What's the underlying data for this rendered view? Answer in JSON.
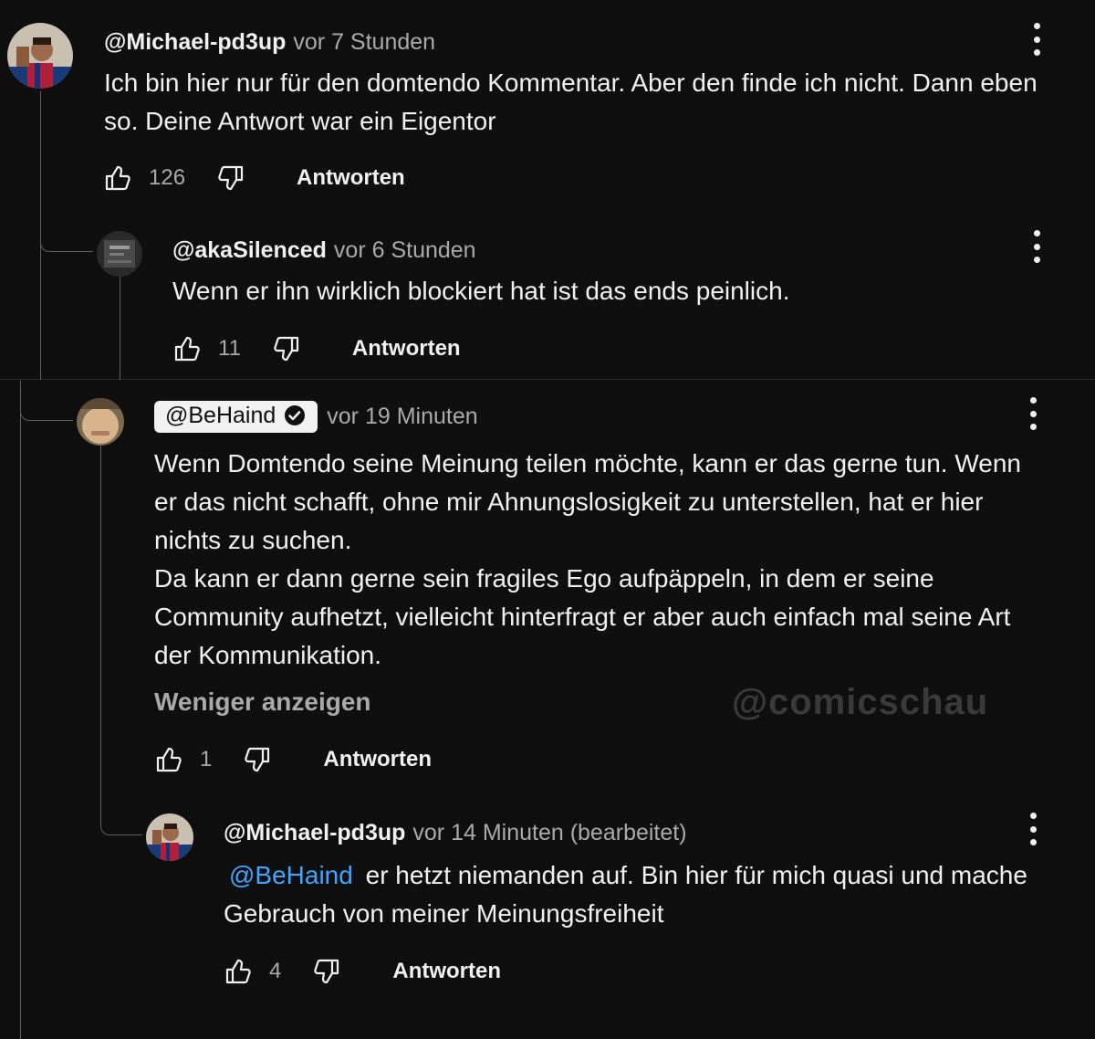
{
  "comments": {
    "c1": {
      "author": "@Michael-pd3up",
      "time": "vor 7 Stunden",
      "line1": "Ich bin hier nur für den domtendo Kommentar. Aber den finde ich nicht. Dann eben",
      "line2": "so. Deine Antwort war ein Eigentor",
      "likes": "126",
      "reply_label": "Antworten"
    },
    "c2": {
      "author": "@akaSilenced",
      "time": "vor 6 Stunden",
      "line1": "Wenn er ihn wirklich blockiert hat ist das ends peinlich.",
      "likes": "11",
      "reply_label": "Antworten"
    },
    "c3": {
      "author": "@BeHaind",
      "time": "vor 19 Minuten",
      "lines": [
        "Wenn Domtendo seine Meinung teilen möchte, kann er das gerne tun. Wenn",
        "er das nicht schafft, ohne mir Ahnungslosigkeit zu unterstellen, hat er hier",
        "nichts zu suchen.",
        "Da kann er dann gerne sein fragiles Ego aufpäppeln, in dem er seine",
        "Community aufhetzt, vielleicht hinterfragt er aber auch einfach mal seine Art",
        "der Kommunikation."
      ],
      "show_less": "Weniger anzeigen",
      "likes": "1",
      "reply_label": "Antworten"
    },
    "c4": {
      "author": "@Michael-pd3up",
      "time": "vor 14 Minuten (bearbeitet)",
      "mention": "@BeHaind",
      "line1": "er hetzt niemanden auf. Bin hier für mich quasi und mache",
      "line2": "Gebrauch von meiner Meinungsfreiheit",
      "likes": "4",
      "reply_label": "Antworten"
    }
  },
  "watermark": "@comicschau",
  "colors": {
    "background": "#0f0f0f",
    "text": "#f1f1f1",
    "secondary": "#aaaaaa",
    "mention": "#3ea6ff"
  },
  "icons": [
    "like-icon",
    "dislike-icon",
    "more-vert-icon",
    "verified-check-icon"
  ]
}
